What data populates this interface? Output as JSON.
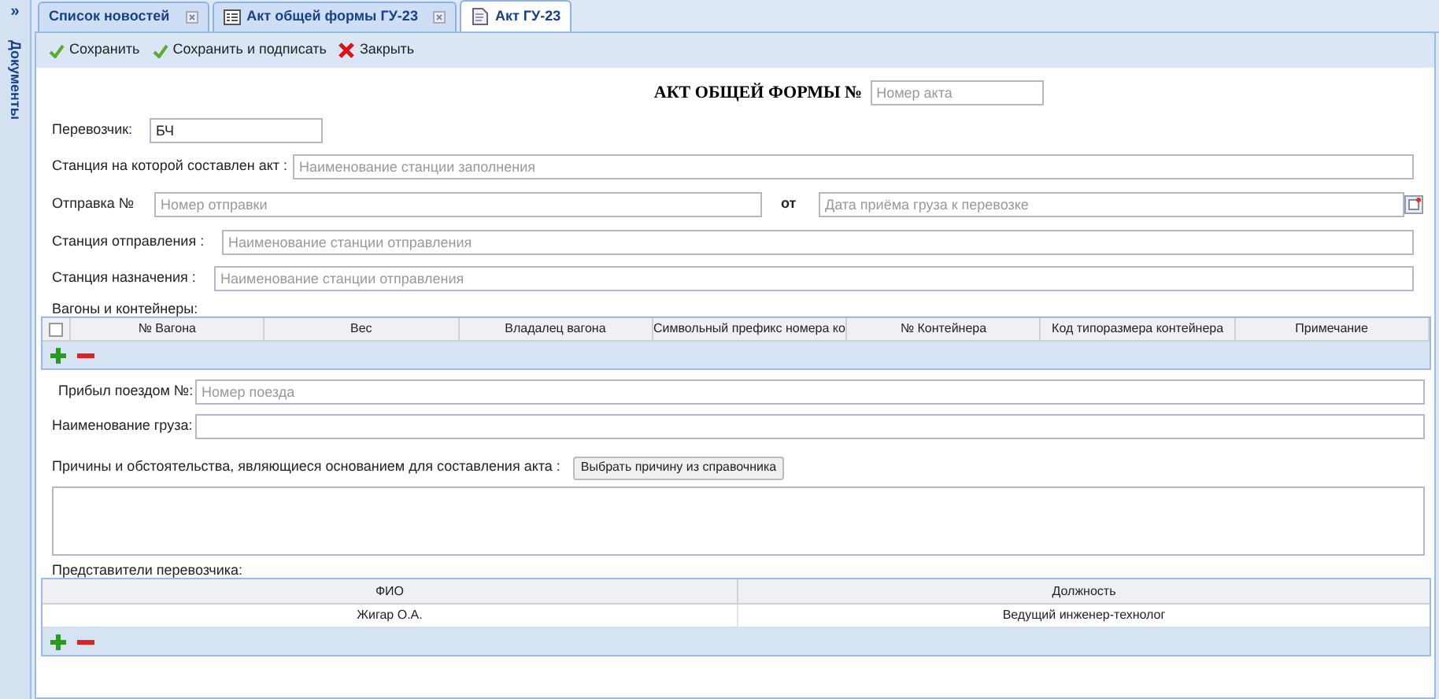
{
  "sidebar": {
    "toggle": "»",
    "title": "Документы"
  },
  "tabs": [
    {
      "label": "Список новостей",
      "selected": false,
      "closable": true
    },
    {
      "label": "Акт общей формы ГУ-23",
      "selected": false,
      "closable": true
    },
    {
      "label": "Акт ГУ-23",
      "selected": true,
      "closable": false
    }
  ],
  "toolbar": [
    {
      "label": "Сохранить",
      "kind": "check"
    },
    {
      "label": "Сохранить и подписать",
      "kind": "check"
    },
    {
      "label": "Закрыть",
      "kind": "close"
    }
  ],
  "form": {
    "title": "АКТ ОБЩЕЙ ФОРМЫ №",
    "act_number": {
      "placeholder": "Номер акта"
    },
    "carrier": {
      "label": "Перевозчик:",
      "value": "БЧ"
    },
    "station_made": {
      "label": "Станция на которой составлен акт :",
      "placeholder": "Наименование станции заполнения"
    },
    "shipment": {
      "label": "Отправка №",
      "placeholder": "Номер отправки",
      "date_label": "от",
      "date_placeholder": "Дата приёма груза к перевозке"
    },
    "departure_station": {
      "label": "Станция отправления :",
      "placeholder": "Наименование станции отправления"
    },
    "destination_station": {
      "label": "Станция назначения :",
      "placeholder": "Наименование станции отправления"
    },
    "wagons": {
      "label": "Вагоны и контейнеры:",
      "select_all_checked": false,
      "columns": [
        "№ Вагона",
        "Вес",
        "Владалец вагона",
        "Символьный префикс номера ко",
        "№ Контейнера",
        "Код типоразмера контейнера",
        "Примечание"
      ]
    },
    "train": {
      "label": "Прибыл поездом №:",
      "placeholder": "Номер поезда"
    },
    "cargo": {
      "label": "Наименование груза:"
    },
    "reasons": {
      "label": "Причины и обстоятельства, являющиеся основанием для составления акта :",
      "button": "Выбрать причину из справочника"
    },
    "representatives": {
      "label": "Представители перевозчика:",
      "columns": [
        "ФИО",
        "Должность"
      ],
      "rows": [
        [
          "Жигар О.А.",
          "Ведущий инженер-технолог"
        ]
      ]
    }
  }
}
